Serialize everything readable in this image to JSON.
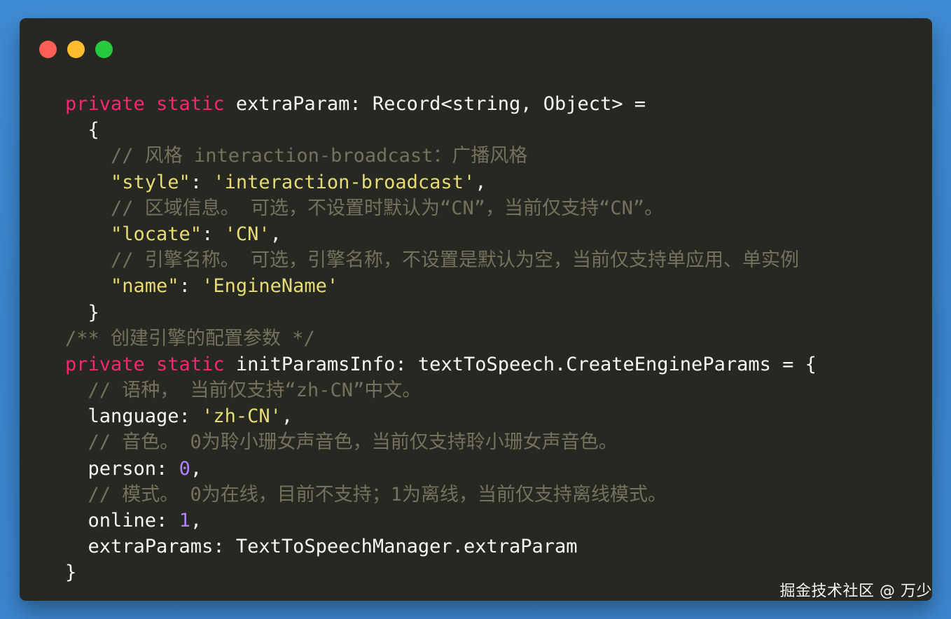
{
  "window": {
    "controls": {
      "close_color": "#ff5f56",
      "minimize_color": "#ffbd2e",
      "maximize_color": "#27c93f"
    }
  },
  "code": {
    "lines": [
      [
        {
          "t": "private ",
          "k": "kw"
        },
        {
          "t": "static ",
          "k": "kw"
        },
        {
          "t": "extraParam: Record<string, Object> =",
          "k": "plain"
        }
      ],
      [
        {
          "t": "  {",
          "k": "plain"
        }
      ],
      [
        {
          "t": "    // 风格 interaction-broadcast：广播风格",
          "k": "com"
        }
      ],
      [
        {
          "t": "    \"style\"",
          "k": "str"
        },
        {
          "t": ": ",
          "k": "plain"
        },
        {
          "t": "'interaction-broadcast'",
          "k": "str"
        },
        {
          "t": ",",
          "k": "plain"
        }
      ],
      [
        {
          "t": "    // 区域信息。 可选，不设置时默认为“CN”，当前仅支持“CN”。",
          "k": "com"
        }
      ],
      [
        {
          "t": "    \"locate\"",
          "k": "str"
        },
        {
          "t": ": ",
          "k": "plain"
        },
        {
          "t": "'CN'",
          "k": "str"
        },
        {
          "t": ",",
          "k": "plain"
        }
      ],
      [
        {
          "t": "    // 引擎名称。 可选，引擎名称，不设置是默认为空，当前仅支持单应用、单实例",
          "k": "com"
        }
      ],
      [
        {
          "t": "    \"name\"",
          "k": "str"
        },
        {
          "t": ": ",
          "k": "plain"
        },
        {
          "t": "'EngineName'",
          "k": "str"
        }
      ],
      [
        {
          "t": "  }",
          "k": "plain"
        }
      ],
      [
        {
          "t": "/** 创建引擎的配置参数 */",
          "k": "com"
        }
      ],
      [
        {
          "t": "private ",
          "k": "kw"
        },
        {
          "t": "static ",
          "k": "kw"
        },
        {
          "t": "initParamsInfo: textToSpeech.CreateEngineParams = {",
          "k": "plain"
        }
      ],
      [
        {
          "t": "  // 语种， 当前仅支持“zh-CN”中文。",
          "k": "com"
        }
      ],
      [
        {
          "t": "  language: ",
          "k": "plain"
        },
        {
          "t": "'zh-CN'",
          "k": "str"
        },
        {
          "t": ",",
          "k": "plain"
        }
      ],
      [
        {
          "t": "  // 音色。 0为聆小珊女声音色，当前仅支持聆小珊女声音色。",
          "k": "com"
        }
      ],
      [
        {
          "t": "  person: ",
          "k": "plain"
        },
        {
          "t": "0",
          "k": "num"
        },
        {
          "t": ",",
          "k": "plain"
        }
      ],
      [
        {
          "t": "  // 模式。 0为在线，目前不支持；1为离线，当前仅支持离线模式。",
          "k": "com"
        }
      ],
      [
        {
          "t": "  online: ",
          "k": "plain"
        },
        {
          "t": "1",
          "k": "num"
        },
        {
          "t": ",",
          "k": "plain"
        }
      ],
      [
        {
          "t": "  extraParams: TextToSpeechManager.extraParam",
          "k": "plain"
        }
      ],
      [
        {
          "t": "}",
          "k": "plain"
        }
      ]
    ]
  },
  "watermark": {
    "text": "掘金技术社区 @ 万少"
  }
}
